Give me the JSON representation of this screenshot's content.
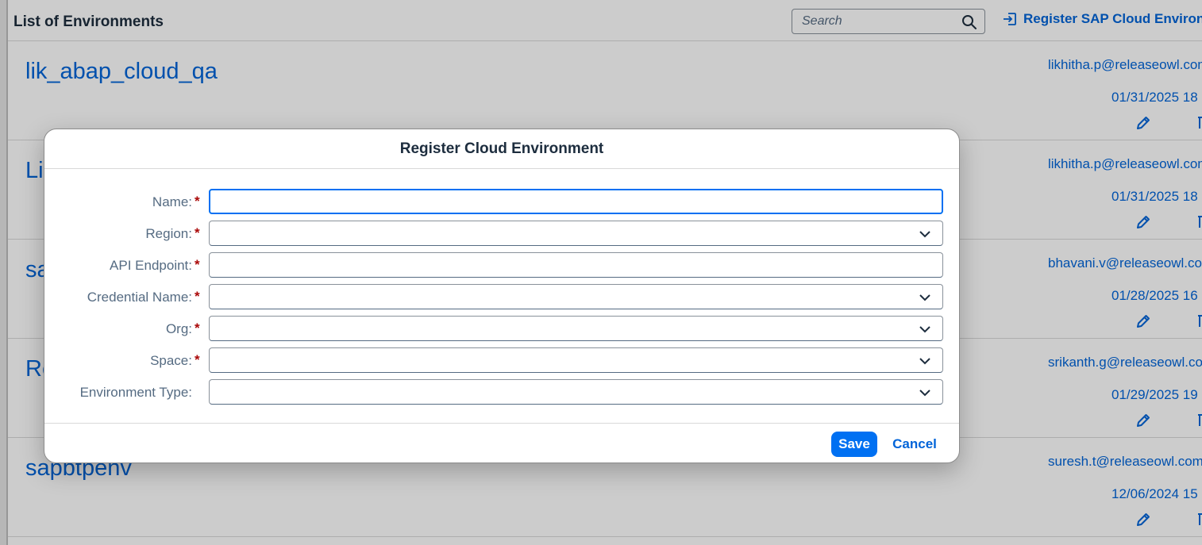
{
  "toolbar": {
    "title": "List of Environments",
    "search_placeholder": "Search",
    "register_label": "Register SAP Cloud Environment"
  },
  "environments": [
    {
      "name": "lik_abap_cloud_qa",
      "owner": "likhitha.p@releaseowl.com",
      "date": "01/31/2025 18"
    },
    {
      "name": "Li",
      "owner": "likhitha.p@releaseowl.com",
      "date": "01/31/2025 18"
    },
    {
      "name": "sa",
      "owner": "bhavani.v@releaseowl.com",
      "date": "01/28/2025 16"
    },
    {
      "name": "Re",
      "owner": "srikanth.g@releaseowl.com",
      "date": "01/29/2025 19"
    },
    {
      "name": "sapbtpenv",
      "owner": "suresh.t@releaseowl.com",
      "date": "12/06/2024 15"
    }
  ],
  "dialog": {
    "title": "Register Cloud Environment",
    "fields": [
      {
        "label": "Name:",
        "required": "*",
        "type": "text",
        "value": ""
      },
      {
        "label": "Region:",
        "required": "*",
        "type": "select",
        "value": ""
      },
      {
        "label": "API Endpoint:",
        "required": "*",
        "type": "text",
        "value": ""
      },
      {
        "label": "Credential Name:",
        "required": "*",
        "type": "select",
        "value": ""
      },
      {
        "label": "Org:",
        "required": "*",
        "type": "select",
        "value": ""
      },
      {
        "label": "Space:",
        "required": "*",
        "type": "select",
        "value": ""
      },
      {
        "label": "Environment Type:",
        "required": "",
        "type": "select",
        "value": ""
      }
    ],
    "save_label": "Save",
    "cancel_label": "Cancel"
  }
}
